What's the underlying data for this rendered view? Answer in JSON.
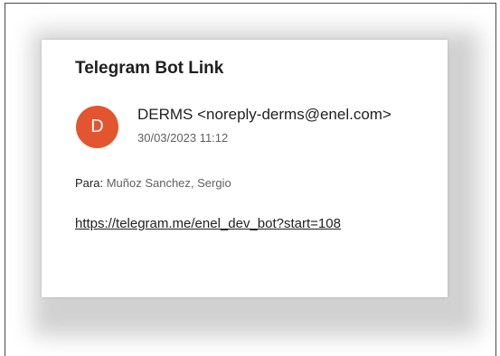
{
  "email": {
    "subject": "Telegram Bot Link",
    "avatar_initial": "D",
    "sender": "DERMS <noreply-derms@enel.com>",
    "date": "30/03/2023 11:12",
    "to_label": "Para:",
    "to_value": "Muñoz Sanchez, Sergio",
    "body_link": "https://telegram.me/enel_dev_bot?start=108"
  },
  "colors": {
    "avatar_bg": "#e2552f",
    "text_primary": "#1f1f1f",
    "text_secondary": "#616161"
  }
}
